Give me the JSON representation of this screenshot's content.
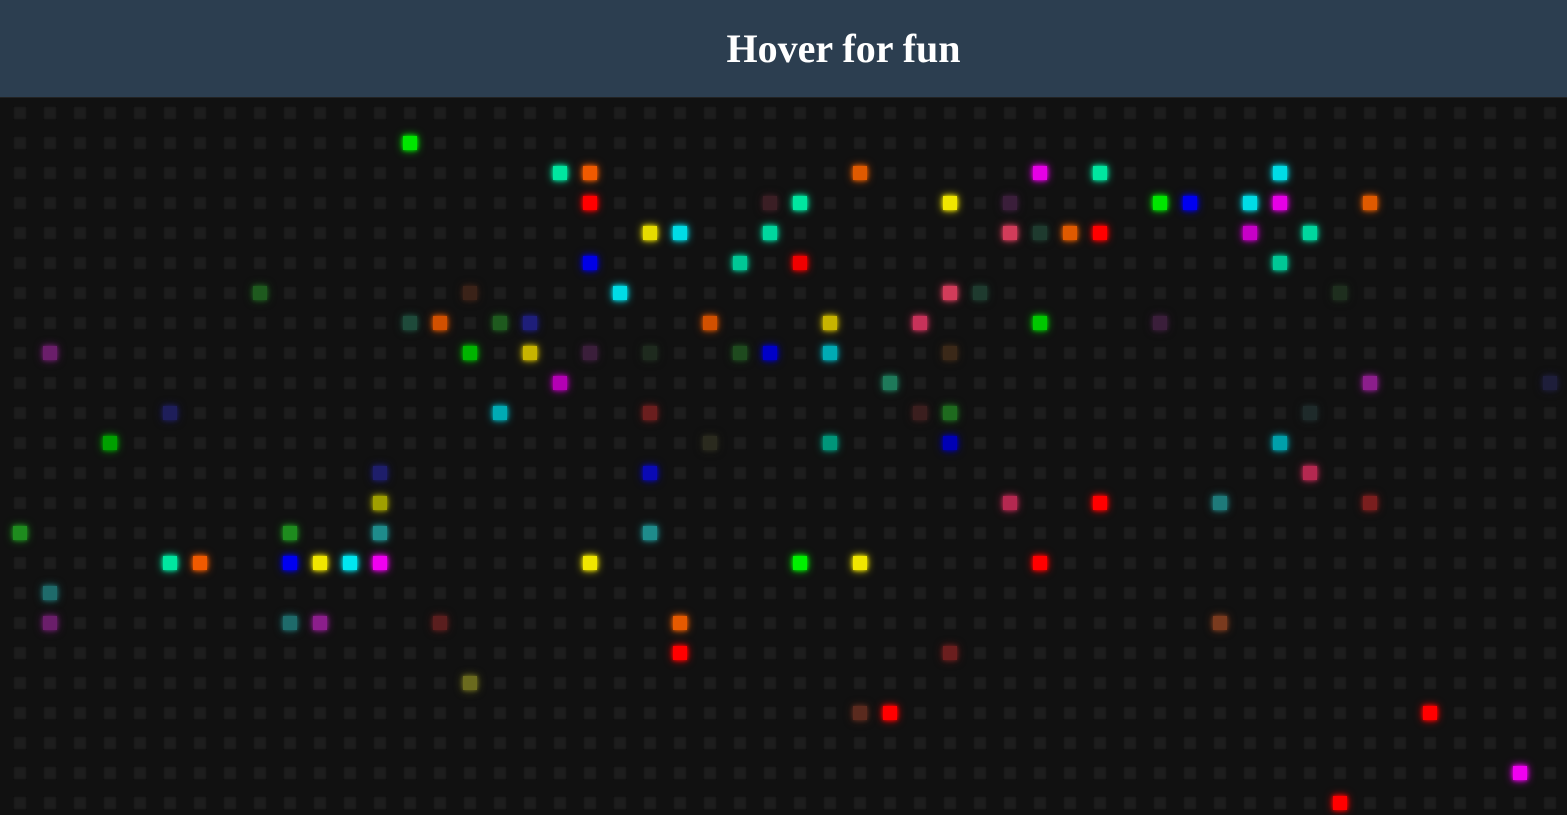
{
  "header": {
    "title": "Hover for fun",
    "background": "#2c3e50"
  },
  "grid": {
    "cols": 53,
    "rows": 24,
    "cell_color": "#1d1d1d",
    "background": "#111111",
    "lit_cells": [
      {
        "c": 13,
        "r": 1,
        "color": "#00e600"
      },
      {
        "c": 18,
        "r": 2,
        "color": "#00e6a0"
      },
      {
        "c": 19,
        "r": 2,
        "color": "#f05a00"
      },
      {
        "c": 28,
        "r": 2,
        "color": "#e05a00"
      },
      {
        "c": 34,
        "r": 2,
        "color": "#e600e6"
      },
      {
        "c": 36,
        "r": 2,
        "color": "#00e6a0"
      },
      {
        "c": 42,
        "r": 2,
        "color": "#00dce6"
      },
      {
        "c": 19,
        "r": 3,
        "color": "#ff0000"
      },
      {
        "c": 25,
        "r": 3,
        "color": "#3a1e24"
      },
      {
        "c": 26,
        "r": 3,
        "color": "#00e6a0"
      },
      {
        "c": 31,
        "r": 3,
        "color": "#f0e600"
      },
      {
        "c": 33,
        "r": 3,
        "color": "#3a1e3a"
      },
      {
        "c": 38,
        "r": 3,
        "color": "#00e600"
      },
      {
        "c": 39,
        "r": 3,
        "color": "#0000f0"
      },
      {
        "c": 41,
        "r": 3,
        "color": "#00dce6"
      },
      {
        "c": 42,
        "r": 3,
        "color": "#e600e6"
      },
      {
        "c": 45,
        "r": 3,
        "color": "#e05a00"
      },
      {
        "c": 21,
        "r": 4,
        "color": "#e6dc00"
      },
      {
        "c": 22,
        "r": 4,
        "color": "#00dce6"
      },
      {
        "c": 25,
        "r": 4,
        "color": "#00d69e"
      },
      {
        "c": 33,
        "r": 4,
        "color": "#d23c5a"
      },
      {
        "c": 34,
        "r": 4,
        "color": "#1e3a2e"
      },
      {
        "c": 35,
        "r": 4,
        "color": "#e05a00"
      },
      {
        "c": 36,
        "r": 4,
        "color": "#ff0000"
      },
      {
        "c": 41,
        "r": 4,
        "color": "#c800c8"
      },
      {
        "c": 43,
        "r": 4,
        "color": "#00d69e"
      },
      {
        "c": 19,
        "r": 5,
        "color": "#0000e6"
      },
      {
        "c": 24,
        "r": 5,
        "color": "#00c896"
      },
      {
        "c": 26,
        "r": 5,
        "color": "#f00000"
      },
      {
        "c": 42,
        "r": 5,
        "color": "#00c896"
      },
      {
        "c": 8,
        "r": 6,
        "color": "#1e5a1e"
      },
      {
        "c": 15,
        "r": 6,
        "color": "#3a2218"
      },
      {
        "c": 20,
        "r": 6,
        "color": "#00dce6"
      },
      {
        "c": 31,
        "r": 6,
        "color": "#d23c5a"
      },
      {
        "c": 32,
        "r": 6,
        "color": "#1e3a2e"
      },
      {
        "c": 44,
        "r": 6,
        "color": "#1e2e1e"
      },
      {
        "c": 13,
        "r": 7,
        "color": "#1e4a3a"
      },
      {
        "c": 14,
        "r": 7,
        "color": "#d25000"
      },
      {
        "c": 16,
        "r": 7,
        "color": "#1e5a1e"
      },
      {
        "c": 17,
        "r": 7,
        "color": "#1e1e7a"
      },
      {
        "c": 23,
        "r": 7,
        "color": "#d25000"
      },
      {
        "c": 27,
        "r": 7,
        "color": "#c8b400"
      },
      {
        "c": 30,
        "r": 7,
        "color": "#c8325a"
      },
      {
        "c": 34,
        "r": 7,
        "color": "#00c800"
      },
      {
        "c": 38,
        "r": 7,
        "color": "#3a1e3a"
      },
      {
        "c": 1,
        "r": 8,
        "color": "#6a1e6a"
      },
      {
        "c": 15,
        "r": 8,
        "color": "#00b400"
      },
      {
        "c": 17,
        "r": 8,
        "color": "#c8b400"
      },
      {
        "c": 19,
        "r": 8,
        "color": "#3a1e3a"
      },
      {
        "c": 21,
        "r": 8,
        "color": "#1e2a1e"
      },
      {
        "c": 24,
        "r": 8,
        "color": "#1e4a1e"
      },
      {
        "c": 25,
        "r": 8,
        "color": "#0000c8"
      },
      {
        "c": 27,
        "r": 8,
        "color": "#00aab4"
      },
      {
        "c": 31,
        "r": 8,
        "color": "#3a2818"
      },
      {
        "c": 18,
        "r": 9,
        "color": "#b400b4"
      },
      {
        "c": 29,
        "r": 9,
        "color": "#1e7a5a"
      },
      {
        "c": 45,
        "r": 9,
        "color": "#8c1e8c"
      },
      {
        "c": 51,
        "r": 9,
        "color": "#1e1e3a"
      },
      {
        "c": 5,
        "r": 10,
        "color": "#1e1e5a"
      },
      {
        "c": 16,
        "r": 10,
        "color": "#00aab4"
      },
      {
        "c": 21,
        "r": 10,
        "color": "#6a1e1e"
      },
      {
        "c": 30,
        "r": 10,
        "color": "#3a1e1e"
      },
      {
        "c": 31,
        "r": 10,
        "color": "#1e6a1e"
      },
      {
        "c": 43,
        "r": 10,
        "color": "#1e2a2a"
      },
      {
        "c": 3,
        "r": 11,
        "color": "#00a000"
      },
      {
        "c": 23,
        "r": 11,
        "color": "#2a2a1e"
      },
      {
        "c": 27,
        "r": 11,
        "color": "#00967a"
      },
      {
        "c": 31,
        "r": 11,
        "color": "#0000b4"
      },
      {
        "c": 42,
        "r": 11,
        "color": "#00a0aa"
      },
      {
        "c": 12,
        "r": 12,
        "color": "#1e1e6a"
      },
      {
        "c": 21,
        "r": 12,
        "color": "#0a0ab4"
      },
      {
        "c": 43,
        "r": 12,
        "color": "#b42850"
      },
      {
        "c": 12,
        "r": 13,
        "color": "#a0a000"
      },
      {
        "c": 33,
        "r": 13,
        "color": "#b42850"
      },
      {
        "c": 36,
        "r": 13,
        "color": "#ff0000"
      },
      {
        "c": 40,
        "r": 13,
        "color": "#1e7a7a"
      },
      {
        "c": 45,
        "r": 13,
        "color": "#7a1e1e"
      },
      {
        "c": 0,
        "r": 14,
        "color": "#1e8c1e"
      },
      {
        "c": 9,
        "r": 14,
        "color": "#1e8c1e"
      },
      {
        "c": 12,
        "r": 14,
        "color": "#1e8c8c"
      },
      {
        "c": 21,
        "r": 14,
        "color": "#1e8c8c"
      },
      {
        "c": 5,
        "r": 15,
        "color": "#00e6a0"
      },
      {
        "c": 6,
        "r": 15,
        "color": "#f05a00"
      },
      {
        "c": 9,
        "r": 15,
        "color": "#0000f0"
      },
      {
        "c": 10,
        "r": 15,
        "color": "#f0e600"
      },
      {
        "c": 11,
        "r": 15,
        "color": "#00e6f0"
      },
      {
        "c": 12,
        "r": 15,
        "color": "#f000f0"
      },
      {
        "c": 19,
        "r": 15,
        "color": "#f0e600"
      },
      {
        "c": 26,
        "r": 15,
        "color": "#00f000"
      },
      {
        "c": 28,
        "r": 15,
        "color": "#f0e600"
      },
      {
        "c": 34,
        "r": 15,
        "color": "#ff0000"
      },
      {
        "c": 1,
        "r": 16,
        "color": "#1e6a6a"
      },
      {
        "c": 1,
        "r": 17,
        "color": "#6a1e6a"
      },
      {
        "c": 9,
        "r": 17,
        "color": "#1e6a6a"
      },
      {
        "c": 10,
        "r": 17,
        "color": "#8c1e8c"
      },
      {
        "c": 14,
        "r": 17,
        "color": "#5a1e1e"
      },
      {
        "c": 22,
        "r": 17,
        "color": "#e65a00"
      },
      {
        "c": 40,
        "r": 17,
        "color": "#7a3a1e"
      },
      {
        "c": 22,
        "r": 18,
        "color": "#ff0000"
      },
      {
        "c": 31,
        "r": 18,
        "color": "#6a1e1e"
      },
      {
        "c": 15,
        "r": 19,
        "color": "#6a6a1e"
      },
      {
        "c": 28,
        "r": 20,
        "color": "#5a2a1e"
      },
      {
        "c": 29,
        "r": 20,
        "color": "#ff0000"
      },
      {
        "c": 47,
        "r": 20,
        "color": "#ff0000"
      },
      {
        "c": 50,
        "r": 22,
        "color": "#f000f0"
      },
      {
        "c": 44,
        "r": 23,
        "color": "#ff0000"
      }
    ]
  }
}
